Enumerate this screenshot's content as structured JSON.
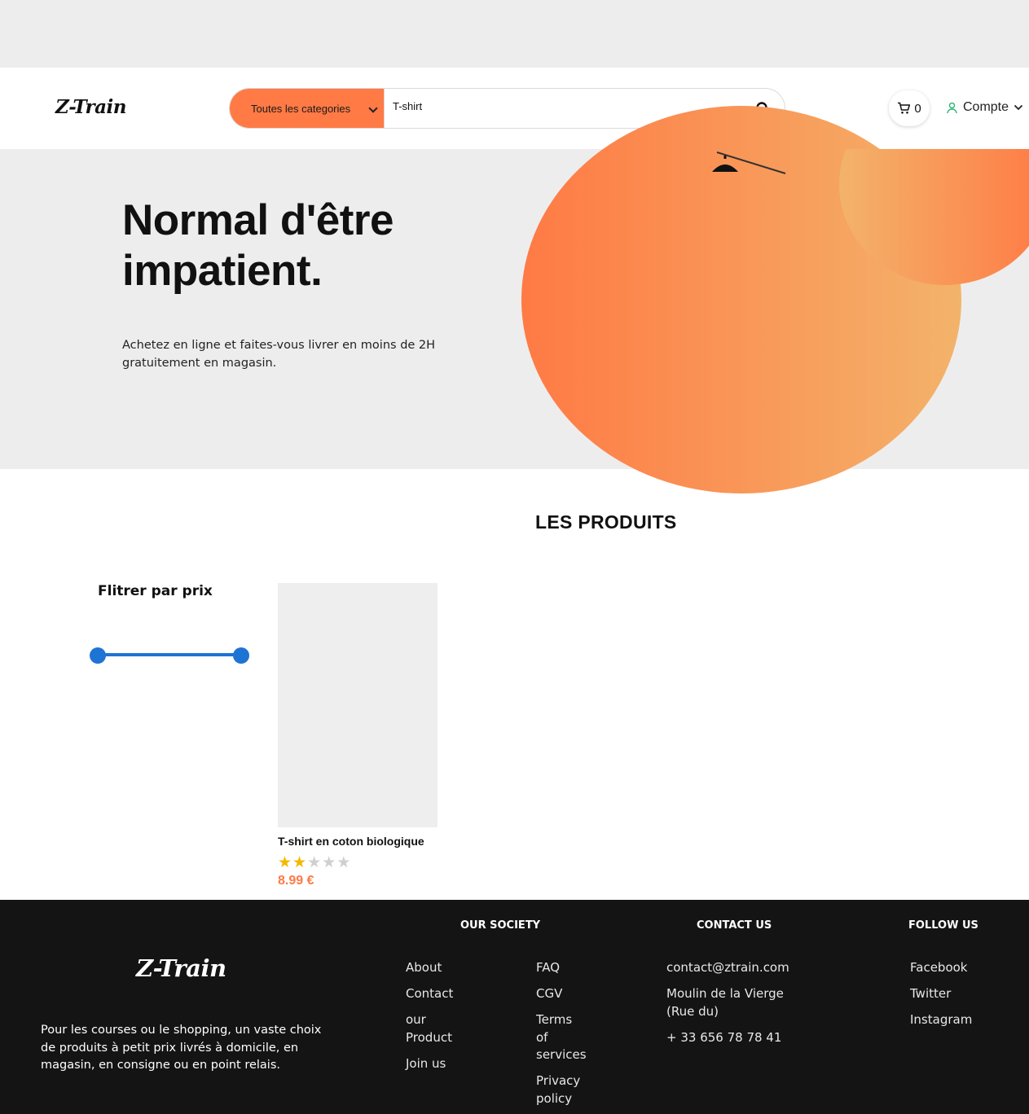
{
  "brand": {
    "logo_text": "Z-Train",
    "accent_color": "#ff7a45",
    "slider_color": "#1e74d4"
  },
  "header": {
    "category_select": "Toutes les categories",
    "search_value": "T-shirt",
    "cart_count": "0",
    "account_label": "Compte"
  },
  "hero": {
    "title": "Normal d'être impatient.",
    "subtitle": "Achetez en ligne et faites-vous livrer en moins de 2H gratuitement en magasin."
  },
  "products_section": {
    "title": "LES PRODUITS",
    "filter_title": "Flitrer par prix",
    "price_range": {
      "min_fraction": 0.0,
      "max_fraction": 1.0
    },
    "items": [
      {
        "name": "T-shirt en coton biologique",
        "rating": 2,
        "rating_max": 5,
        "price": "8.99 €"
      }
    ]
  },
  "footer": {
    "logo_text": "Z-Train",
    "description": "Pour les courses ou le shopping, un vaste choix de produits à petit prix livrés à domicile, en magasin, en consigne ou en point relais.",
    "society": {
      "heading": "OUR SOCIETY",
      "col1": [
        "About",
        "Contact",
        "our Product",
        "Join us"
      ],
      "col2": [
        "FAQ",
        "CGV",
        "Terms of services",
        "Privacy policy"
      ]
    },
    "contact": {
      "heading": "CONTACT US",
      "email": "contact@ztrain.com",
      "address": "Moulin de la Vierge (Rue du)",
      "phone": "+ 33 656 78 78 41"
    },
    "follow": {
      "heading": "FOLLOW US",
      "links": [
        "Facebook",
        "Twitter",
        "Instagram"
      ]
    }
  }
}
